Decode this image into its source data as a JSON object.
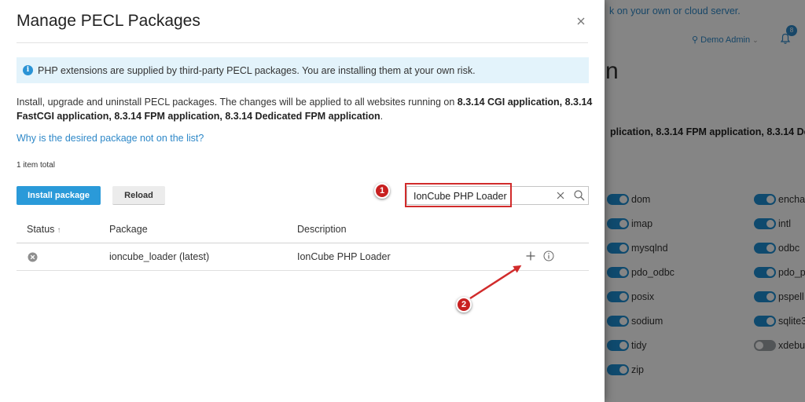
{
  "background": {
    "link_fragment": "k on your own or cloud server.",
    "user_name": "Demo Admin",
    "user_caret": "⌄",
    "notification_count": "8",
    "title_fragment": "n",
    "description_fragment": "plication, 8.3.14 FPM application, 8.3.14 Dedi",
    "extensions_col1": [
      {
        "name": "dom",
        "enabled": true
      },
      {
        "name": "imap",
        "enabled": true
      },
      {
        "name": "mysqlnd",
        "enabled": true
      },
      {
        "name": "pdo_odbc",
        "enabled": true
      },
      {
        "name": "posix",
        "enabled": true
      },
      {
        "name": "sodium",
        "enabled": true
      },
      {
        "name": "tidy",
        "enabled": true
      },
      {
        "name": "zip",
        "enabled": true
      }
    ],
    "extensions_col2": [
      {
        "name": "encha",
        "enabled": true
      },
      {
        "name": "intl",
        "enabled": true
      },
      {
        "name": "odbc",
        "enabled": true
      },
      {
        "name": "pdo_p",
        "enabled": true
      },
      {
        "name": "pspell",
        "enabled": true
      },
      {
        "name": "sqlite3",
        "enabled": true
      },
      {
        "name": "xdebu",
        "enabled": false
      }
    ]
  },
  "modal": {
    "title": "Manage PECL Packages",
    "close_icon": "close-icon",
    "alert_icon": "i",
    "alert_text": "PHP extensions are supplied by third-party PECL packages. You are installing them at your own risk.",
    "intro_text": "Install, upgrade and uninstall PECL packages. The changes will be applied to all websites running on ",
    "intro_bold": "8.3.14 CGI application, 8.3.14 FastCGI application, 8.3.14 FPM application, 8.3.14 Dedicated FPM application",
    "intro_end": ".",
    "why_link": "Why is the desired package not on the list?",
    "items_total": "1 item total",
    "install_button": "Install package",
    "reload_button": "Reload",
    "search": {
      "value": "IonCube PHP Loader",
      "placeholder": "Search"
    },
    "table": {
      "columns": {
        "status": "Status",
        "status_sort_arrow": "↑",
        "package": "Package",
        "description": "Description"
      },
      "rows": [
        {
          "status": "not-installed",
          "package": "ioncube_loader (latest)",
          "description": "IonCube PHP Loader"
        }
      ]
    }
  },
  "annotations": {
    "marker_1": "1",
    "marker_2": "2",
    "highlight_color": "#d12b2b"
  },
  "colors": {
    "accent": "#2a9ad9",
    "link": "#2e88c8",
    "alert_bg": "#e3f3fb",
    "annotation_red": "#d12b2b"
  }
}
